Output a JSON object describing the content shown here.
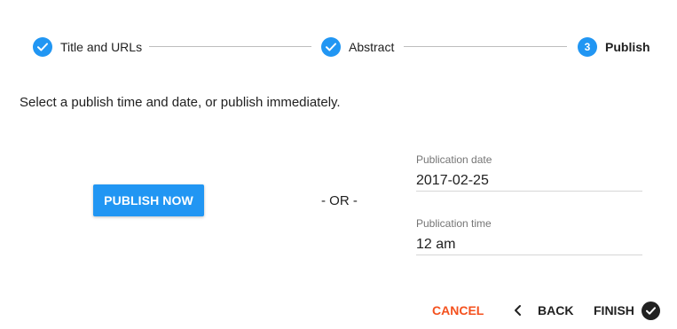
{
  "stepper": {
    "steps": [
      {
        "label": "Title and URLs",
        "state": "completed"
      },
      {
        "label": "Abstract",
        "state": "completed"
      },
      {
        "label": "Publish",
        "number": "3",
        "state": "active"
      }
    ]
  },
  "instruction": "Select a publish time and date, or publish immediately.",
  "publish_now": {
    "label": "PUBLISH NOW"
  },
  "separator": "- OR -",
  "publication_date": {
    "label": "Publication date",
    "value": "2017-02-25"
  },
  "publication_time": {
    "label": "Publication time",
    "value": "12 am"
  },
  "actions": {
    "cancel": "CANCEL",
    "back": "BACK",
    "finish": "FINISH"
  },
  "colors": {
    "primary": "#2196f3",
    "cancel": "#f4511e",
    "text": "#212121",
    "muted": "#757575"
  },
  "icons": {
    "completed_step": "check-circle-icon",
    "back": "chevron-left-icon",
    "finish": "check-circle-icon"
  }
}
